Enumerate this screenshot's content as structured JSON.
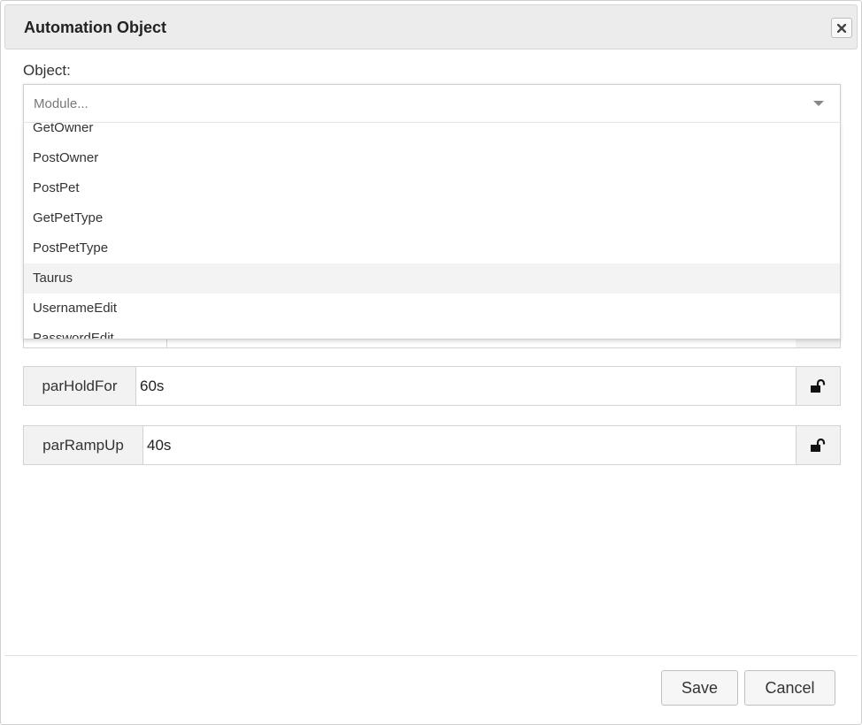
{
  "dialog": {
    "title": "Automation Object",
    "close_icon": "close-icon"
  },
  "object": {
    "label": "Object:",
    "select": {
      "placeholder": "Module...",
      "options": [
        "GetOwner",
        "PostOwner",
        "PostPet",
        "GetPetType",
        "PostPetType",
        "Taurus",
        "UsernameEdit",
        "PasswordEdit"
      ],
      "hovered_option": "Taurus"
    }
  },
  "params": [
    {
      "name": "parHoldFor",
      "value": "60s",
      "lock_icon": "unlock-icon"
    },
    {
      "name": "parRampUp",
      "value": "40s",
      "lock_icon": "unlock-icon"
    }
  ],
  "footer": {
    "save_label": "Save",
    "cancel_label": "Cancel"
  }
}
